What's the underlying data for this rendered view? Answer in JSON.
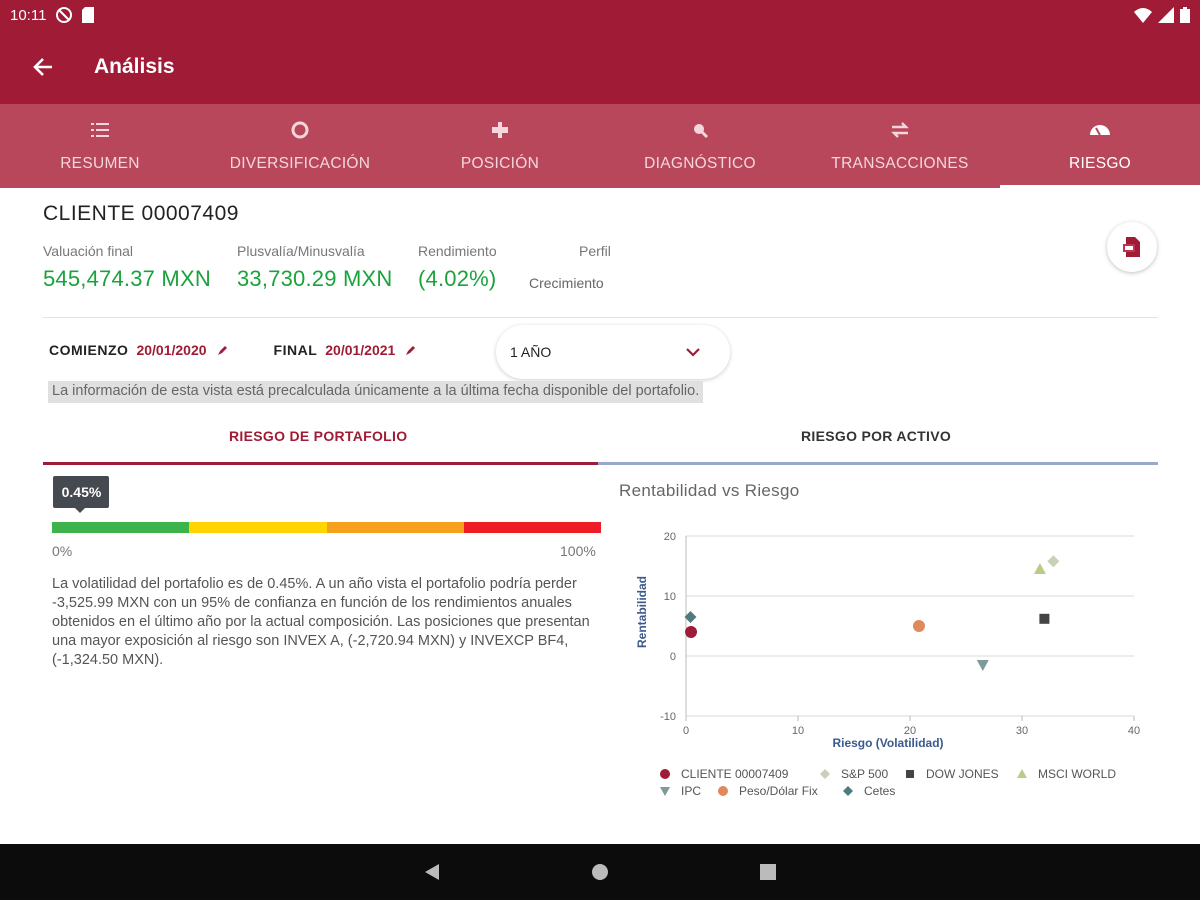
{
  "status": {
    "time": "10:11"
  },
  "appbar": {
    "title": "Análisis"
  },
  "tabs": [
    {
      "label": "RESUMEN",
      "icon": "list-icon"
    },
    {
      "label": "DIVERSIFICACIÓN",
      "icon": "donut-icon"
    },
    {
      "label": "POSICIÓN",
      "icon": "position-icon"
    },
    {
      "label": "DIAGNÓSTICO",
      "icon": "magnifier-icon"
    },
    {
      "label": "TRANSACCIONES",
      "icon": "swap-icon"
    },
    {
      "label": "RIESGO",
      "icon": "gauge-icon"
    }
  ],
  "active_tab": "RIESGO",
  "client": {
    "name": "CLIENTE 00007409"
  },
  "metrics": {
    "valuacion_label": "Valuación final",
    "valuacion_value": "545,474.37 MXN",
    "plusvalia_label": "Plusvalía/Minusvalía",
    "plusvalia_value": "33,730.29 MXN",
    "rendimiento_label": "Rendimiento",
    "rendimiento_value": "(4.02%)",
    "perfil_label": "Perfil",
    "perfil_value": "Crecimiento"
  },
  "dates": {
    "start_label": "COMIENZO",
    "start_value": "20/01/2020",
    "end_label": "FINAL",
    "end_value": "20/01/2021",
    "period_selected": "1 AÑO"
  },
  "note": "La información de esta vista está precalculada únicamente a la última fecha disponible del portafolio.",
  "subtabs": {
    "portfolio": "RIESGO DE PORTAFOLIO",
    "asset": "RIESGO POR ACTIVO"
  },
  "risk": {
    "tooltip": "0.45%",
    "value_fraction": 0.0045,
    "min_label": "0%",
    "max_label": "100%",
    "segment_colors": [
      "#3cb44b",
      "#ffd400",
      "#f7a01d",
      "#ee1c25"
    ],
    "description": "La volatilidad del portafolio es de 0.45%. A un año vista el portafolio podría perder -3,525.99 MXN con un 95% de confianza en función de los rendimientos anuales obtenidos en el último año por la actual composición. Las posiciones que presentan una mayor exposición al riesgo son INVEX A, (-2,720.94 MXN) y INVEXCP BF4, (-1,324.50 MXN)."
  },
  "chart_data": {
    "type": "scatter",
    "title": "Rentabilidad vs Riesgo",
    "xlabel": "Riesgo (Volatilidad)",
    "ylabel": "Rentabilidad",
    "xlim": [
      0,
      40
    ],
    "ylim": [
      -10,
      20
    ],
    "xticks": [
      0,
      10,
      20,
      30,
      40
    ],
    "yticks": [
      -10,
      0,
      10,
      20
    ],
    "grid": true,
    "legend_position": "bottom",
    "series": [
      {
        "name": "CLIENTE 00007409",
        "x": 0.45,
        "y": 4.0,
        "color": "#a01c36",
        "marker": "circle"
      },
      {
        "name": "S&P 500",
        "x": 32.8,
        "y": 15.8,
        "color": "#c8d0b8",
        "marker": "diamond"
      },
      {
        "name": "DOW JONES",
        "x": 32.0,
        "y": 6.2,
        "color": "#444444",
        "marker": "square"
      },
      {
        "name": "MSCI WORLD",
        "x": 31.6,
        "y": 14.5,
        "color": "#b9cc8a",
        "marker": "triangle-up"
      },
      {
        "name": "IPC",
        "x": 26.5,
        "y": -1.5,
        "color": "#7f9a9a",
        "marker": "triangle-down"
      },
      {
        "name": "Peso/Dólar Fix",
        "x": 20.8,
        "y": 5.0,
        "color": "#e08a5c",
        "marker": "circle"
      },
      {
        "name": "Cetes",
        "x": 0.4,
        "y": 6.5,
        "color": "#4f7c7a",
        "marker": "diamond"
      }
    ]
  }
}
